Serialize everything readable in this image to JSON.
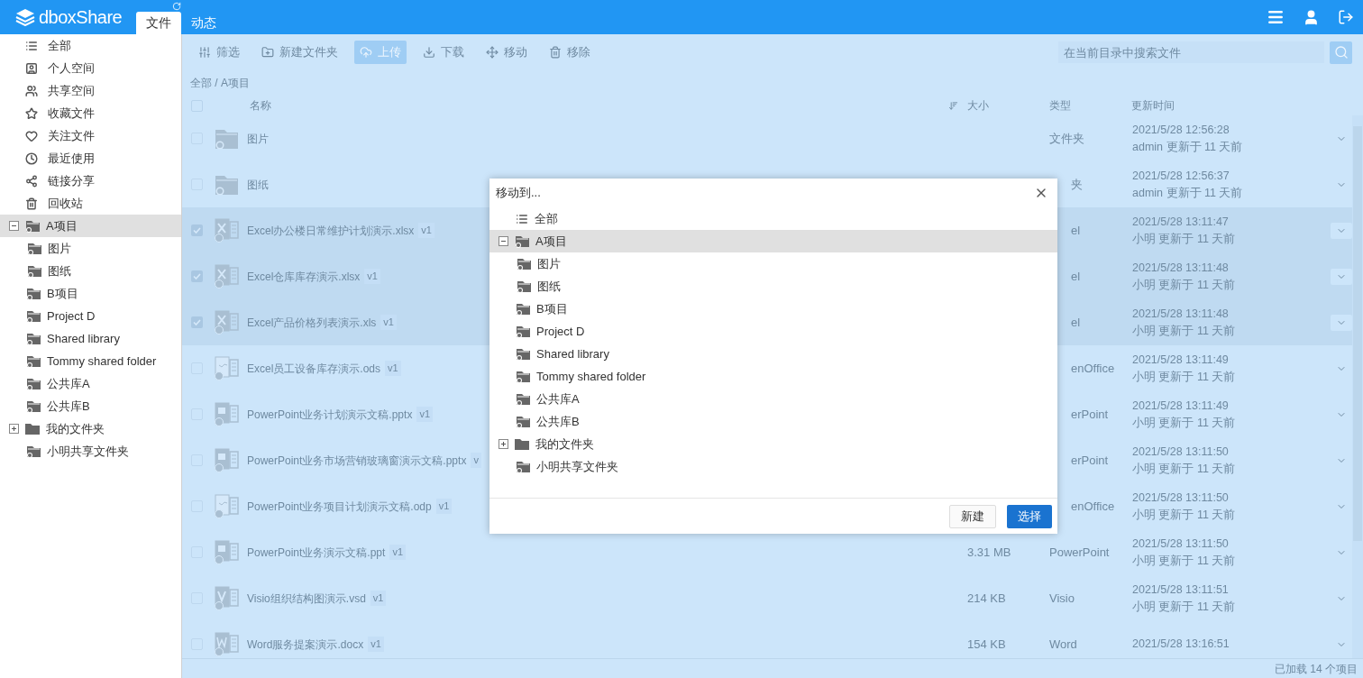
{
  "header": {
    "logo": "dboxShare",
    "tabs": [
      {
        "label": "文件",
        "selected": true
      },
      {
        "label": "动态",
        "selected": false
      }
    ]
  },
  "sidebar": {
    "nav": [
      {
        "label": "全部"
      },
      {
        "label": "个人空间"
      },
      {
        "label": "共享空间"
      },
      {
        "label": "收藏文件"
      },
      {
        "label": "关注文件"
      },
      {
        "label": "最近使用"
      },
      {
        "label": "链接分享"
      },
      {
        "label": "回收站"
      }
    ],
    "tree": [
      {
        "label": "A项目",
        "kind": "shared",
        "selected": true,
        "expanded": true,
        "children": [
          {
            "label": "图片",
            "kind": "shared",
            "selected": false
          },
          {
            "label": "图纸",
            "kind": "shared",
            "selected": false
          }
        ]
      },
      {
        "label": "B项目",
        "kind": "shared",
        "selected": false
      },
      {
        "label": "Project D",
        "kind": "shared",
        "selected": false
      },
      {
        "label": "Shared library",
        "kind": "shared",
        "selected": false
      },
      {
        "label": "Tommy shared folder",
        "kind": "shared",
        "selected": false
      },
      {
        "label": "公共库A",
        "kind": "shared",
        "selected": false
      },
      {
        "label": "公共库B",
        "kind": "shared",
        "selected": false
      },
      {
        "label": "我的文件夹",
        "kind": "plain",
        "selected": false,
        "expanded": false
      },
      {
        "label": "小明共享文件夹",
        "kind": "shared",
        "selected": false
      }
    ]
  },
  "toolbar": {
    "buttons": [
      {
        "label": "筛选",
        "active": false
      },
      {
        "label": "新建文件夹",
        "active": false
      },
      {
        "label": "上传",
        "active": true
      },
      {
        "label": "下载",
        "active": false
      },
      {
        "label": "移动",
        "active": false
      },
      {
        "label": "移除",
        "active": false
      }
    ],
    "search_placeholder": "在当前目录中搜索文件"
  },
  "breadcrumb": "全部 / A项目",
  "table": {
    "columns": [
      "名称",
      "大小",
      "类型",
      "更新时间"
    ],
    "all_selected": false,
    "rows": [
      {
        "kind": "folder",
        "name": "图片",
        "type": "文件夹",
        "updated": "2021/5/28 12:56:28",
        "by": "admin 更新于 11 天前",
        "selected": false
      },
      {
        "kind": "folder",
        "name": "图纸",
        "type_visible": "夹",
        "updated": "2021/5/28 12:56:37",
        "by": "admin 更新于 11 天前",
        "selected": false
      },
      {
        "kind": "excel",
        "name": "Excel办公楼日常维护计划演示.xlsx",
        "version": "v1",
        "type_visible": "el",
        "updated": "2021/5/28 13:11:47",
        "by": "小明 更新于 11 天前",
        "selected": true
      },
      {
        "kind": "excel",
        "name": "Excel仓库库存演示.xlsx",
        "version": "v1",
        "type_visible": "el",
        "updated": "2021/5/28 13:11:48",
        "by": "小明 更新于 11 天前",
        "selected": true
      },
      {
        "kind": "excel",
        "name": "Excel产品价格列表演示.xls",
        "version": "v1",
        "type_visible": "el",
        "updated": "2021/5/28 13:11:48",
        "by": "小明 更新于 11 天前",
        "selected": true
      },
      {
        "kind": "odf",
        "name": "Excel员工设备库存演示.ods",
        "version": "v1",
        "type_visible": "enOffice",
        "updated": "2021/5/28 13:11:49",
        "by": "小明 更新于 11 天前",
        "selected": false
      },
      {
        "kind": "ppt",
        "name": "PowerPoint业务计划演示文稿.pptx",
        "version": "v1",
        "type_visible": "erPoint",
        "updated": "2021/5/28 13:11:49",
        "by": "小明 更新于 11 天前",
        "selected": false
      },
      {
        "kind": "ppt",
        "name": "PowerPoint业务市场营销玻璃窗演示文稿.pptx",
        "version": "v",
        "type_visible": "erPoint",
        "updated": "2021/5/28 13:11:50",
        "by": "小明 更新于 11 天前",
        "selected": false
      },
      {
        "kind": "odf",
        "name": "PowerPoint业务项目计划演示文稿.odp",
        "version": "v1",
        "type_visible": "enOffice",
        "updated": "2021/5/28 13:11:50",
        "by": "小明 更新于 11 天前",
        "selected": false
      },
      {
        "kind": "ppt",
        "name": "PowerPoint业务演示文稿.ppt",
        "version": "v1",
        "size": "3.31 MB",
        "type": "PowerPoint",
        "updated": "2021/5/28 13:11:50",
        "by": "小明 更新于 11 天前",
        "selected": false
      },
      {
        "kind": "visio",
        "name": "Visio组织结构图演示.vsd",
        "version": "v1",
        "size": "214 KB",
        "type": "Visio",
        "updated": "2021/5/28 13:11:51",
        "by": "小明 更新于 11 天前",
        "selected": false
      },
      {
        "kind": "word",
        "name": "Word服务提案演示.docx",
        "version": "v1",
        "size": "154 KB",
        "type": "Word",
        "updated": "2021/5/28 13:16:51",
        "selected": false
      }
    ]
  },
  "status": "已加载 14 个项目",
  "dialog": {
    "title": "移动到...",
    "root": "全部",
    "tree": [
      {
        "label": "A项目",
        "kind": "shared",
        "selected": true,
        "expanded": true,
        "children": [
          {
            "label": "图片",
            "kind": "shared",
            "selected": false
          },
          {
            "label": "图纸",
            "kind": "shared",
            "selected": false
          }
        ]
      },
      {
        "label": "B项目",
        "kind": "shared",
        "selected": false
      },
      {
        "label": "Project D",
        "kind": "shared",
        "selected": false
      },
      {
        "label": "Shared library",
        "kind": "shared",
        "selected": false
      },
      {
        "label": "Tommy shared folder",
        "kind": "shared",
        "selected": false
      },
      {
        "label": "公共库A",
        "kind": "shared",
        "selected": false
      },
      {
        "label": "公共库B",
        "kind": "shared",
        "selected": false
      },
      {
        "label": "我的文件夹",
        "kind": "plain",
        "selected": false,
        "expanded": false
      },
      {
        "label": "小明共享文件夹",
        "kind": "shared",
        "selected": false
      }
    ],
    "buttons": [
      {
        "label": "新建",
        "kind": "secondary"
      },
      {
        "label": "选择",
        "kind": "primary"
      }
    ]
  }
}
